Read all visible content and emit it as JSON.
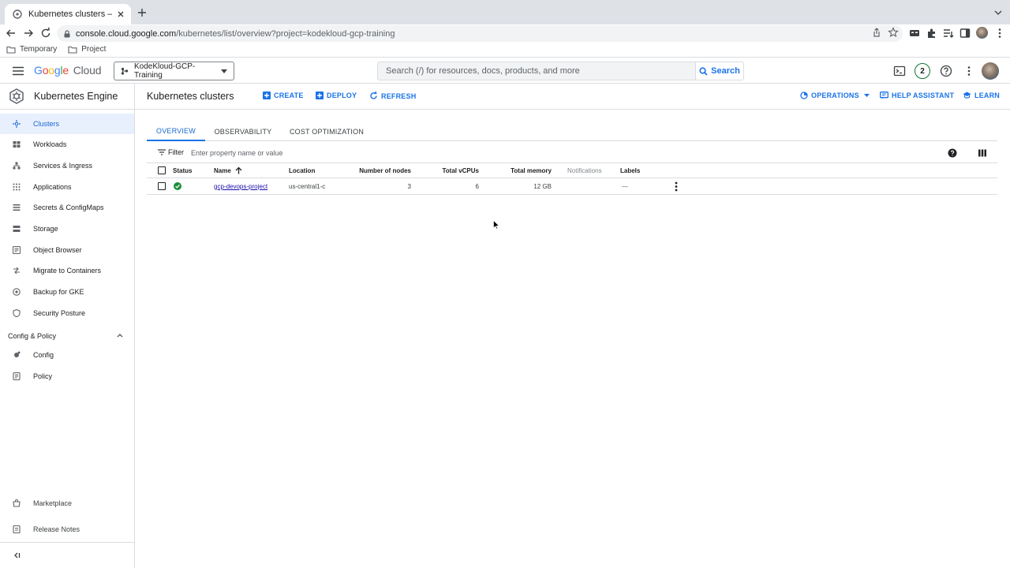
{
  "browser": {
    "tab_title": "Kubernetes clusters – Kubernetes Engine",
    "url_domain": "console.cloud.google.com",
    "url_path": "/kubernetes/list/overview?project=kodekloud-gcp-training",
    "bookmarks": [
      "Temporary",
      "Project"
    ]
  },
  "header": {
    "logo_google": "Google",
    "logo_cloud": "Cloud",
    "project": "KodeKloud-GCP-Training",
    "search_placeholder": "Search (/) for resources, docs, products, and more",
    "search_button": "Search",
    "notifications_count": "2"
  },
  "sidebar": {
    "title": "Kubernetes Engine",
    "items": [
      {
        "label": "Clusters",
        "icon": "clusters-icon"
      },
      {
        "label": "Workloads",
        "icon": "workloads-icon"
      },
      {
        "label": "Services & Ingress",
        "icon": "services-icon"
      },
      {
        "label": "Applications",
        "icon": "applications-icon"
      },
      {
        "label": "Secrets & ConfigMaps",
        "icon": "secrets-icon"
      },
      {
        "label": "Storage",
        "icon": "storage-icon"
      },
      {
        "label": "Object Browser",
        "icon": "object-browser-icon"
      },
      {
        "label": "Migrate to Containers",
        "icon": "migrate-icon"
      },
      {
        "label": "Backup for GKE",
        "icon": "backup-icon"
      },
      {
        "label": "Security Posture",
        "icon": "shield-icon"
      }
    ],
    "section_title": "Config & Policy",
    "section_items": [
      {
        "label": "Config",
        "icon": "config-icon"
      },
      {
        "label": "Policy",
        "icon": "policy-icon"
      }
    ],
    "bottom_items": [
      {
        "label": "Marketplace",
        "icon": "marketplace-icon"
      },
      {
        "label": "Release Notes",
        "icon": "release-notes-icon"
      }
    ]
  },
  "page": {
    "title": "Kubernetes clusters",
    "actions": {
      "create": "CREATE",
      "deploy": "DEPLOY",
      "refresh": "REFRESH"
    },
    "right_actions": {
      "operations": "OPERATIONS",
      "help": "HELP ASSISTANT",
      "learn": "LEARN"
    },
    "tabs": [
      "OVERVIEW",
      "OBSERVABILITY",
      "COST OPTIMIZATION"
    ],
    "filter_label": "Filter",
    "filter_placeholder": "Enter property name or value"
  },
  "table": {
    "columns": {
      "status": "Status",
      "name": "Name",
      "location": "Location",
      "nodes": "Number of nodes",
      "vcpus": "Total vCPUs",
      "memory": "Total memory",
      "notifications": "Notifications",
      "labels": "Labels"
    },
    "rows": [
      {
        "name": "gcp-devops-project",
        "location": "us-central1-c",
        "nodes": "3",
        "vcpus": "6",
        "memory": "12 GB",
        "labels": "—"
      }
    ]
  },
  "colors": {
    "accent": "#1a73e8",
    "status_ok": "#1e8e3e",
    "active_bg": "#e8f0fe"
  }
}
